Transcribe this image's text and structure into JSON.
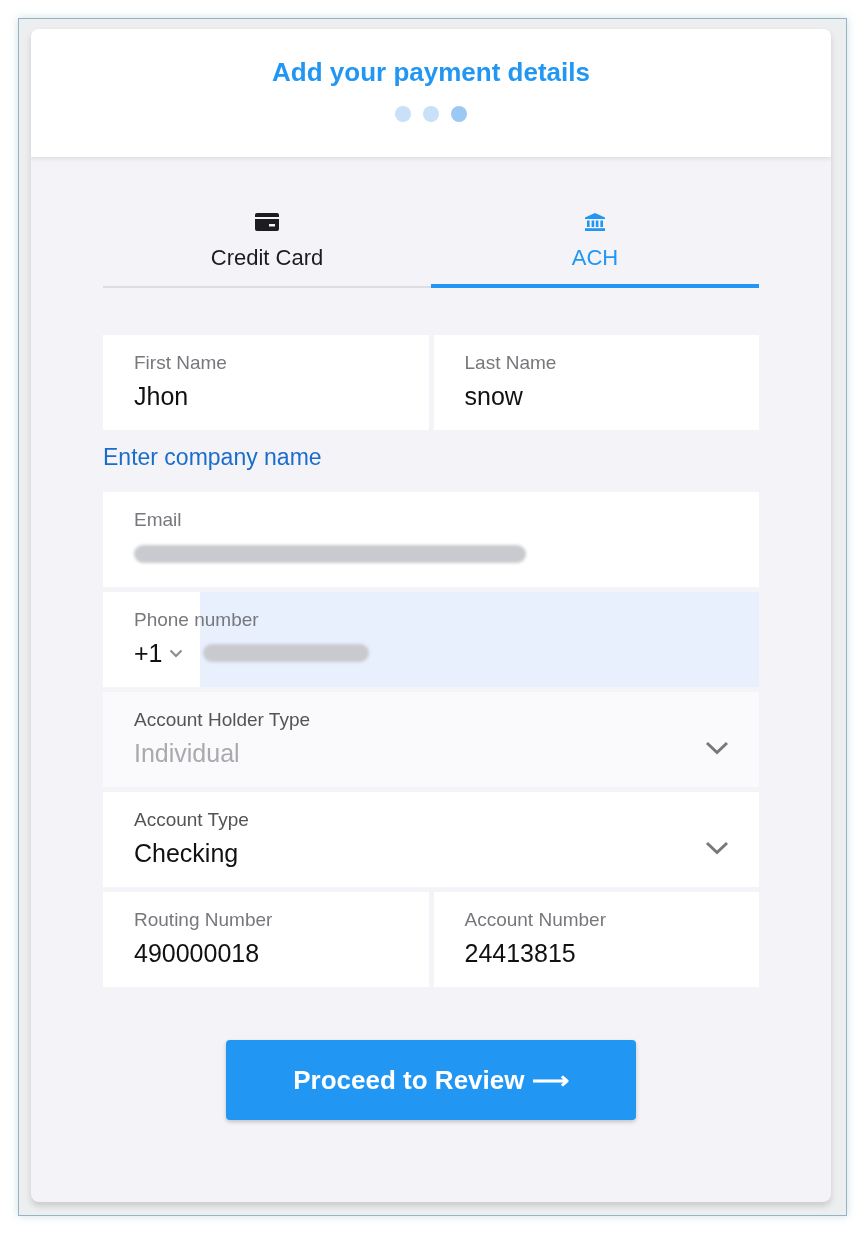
{
  "header": {
    "title": "Add your payment details",
    "steps": [
      {
        "selected": false
      },
      {
        "selected": false
      },
      {
        "selected": true
      }
    ]
  },
  "tabs": [
    {
      "kind": "card",
      "label": "Credit Card",
      "selected": false
    },
    {
      "kind": "bank",
      "label": "ACH",
      "selected": true
    }
  ],
  "form": {
    "name_fields": [
      {
        "label": "First Name",
        "value": "Jhon"
      },
      {
        "label": "Last Name",
        "value": "snow"
      }
    ],
    "company_link": "Enter company name",
    "email": {
      "label": "Email",
      "redacted": true
    },
    "phone": {
      "label": "Phone number",
      "country_code": "+1",
      "redacted": true,
      "highlighted": true
    },
    "selects": [
      {
        "label": "Account Holder Type",
        "value": "Individual",
        "disabled": true
      },
      {
        "label": "Account Type",
        "value": "Checking",
        "disabled": false
      }
    ],
    "number_fields": [
      {
        "label": "Routing Number",
        "value": "490000018"
      },
      {
        "label": "Account Number",
        "value": "24413815"
      }
    ]
  },
  "submit_button": {
    "label": "Proceed to Review ⟶"
  }
}
